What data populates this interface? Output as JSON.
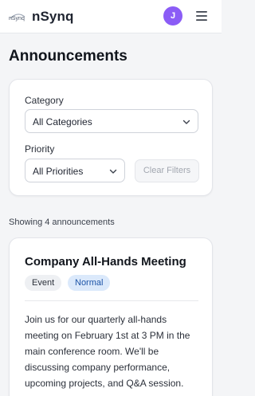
{
  "header": {
    "logo_text": "nSynq",
    "brand_name": "nSynq",
    "avatar_initial": "J",
    "avatar_color": "#8b5cf6",
    "menu_icon": "hamburger-menu-icon"
  },
  "page": {
    "title": "Announcements"
  },
  "filters": {
    "category_label": "Category",
    "category_value": "All Categories",
    "priority_label": "Priority",
    "priority_value": "All Priorities",
    "clear_label": "Clear Filters"
  },
  "results": {
    "count_text": "Showing 4 announcements"
  },
  "announcements": [
    {
      "title": "Company All-Hands Meeting",
      "type": "Event",
      "priority": "Normal",
      "priority_color": "#1e55a8",
      "body": "Join us for our quarterly all-hands meeting on February 1st at 3 PM in the main conference room. We'll be discussing company performance, upcoming projects, and Q&A session."
    }
  ]
}
